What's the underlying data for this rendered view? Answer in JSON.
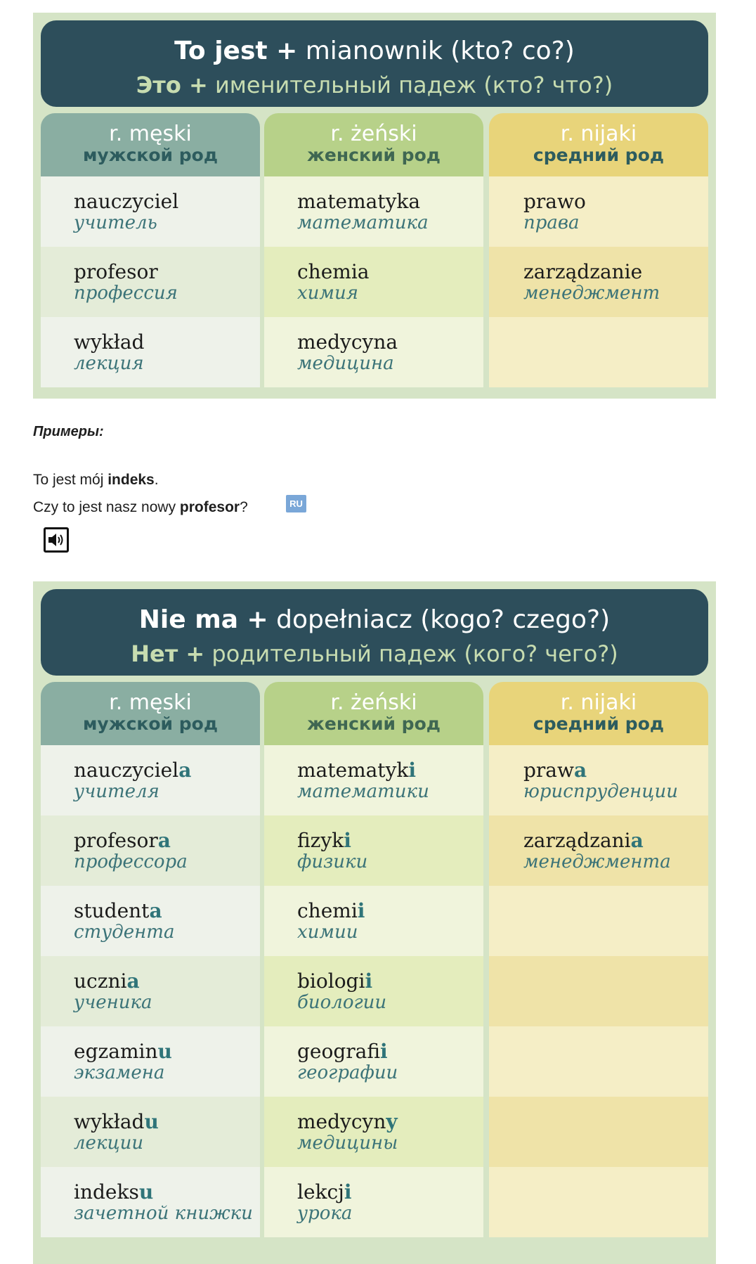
{
  "table1": {
    "title_pl_bold": "To jest +",
    "title_pl_rest": " mianownik (kto? co?)",
    "title_ru_bold": "Это +",
    "title_ru_rest": " именительный падеж (кто? что?)",
    "columns": [
      {
        "header_pl": "r. męski",
        "header_ru": "мужской род",
        "rows": [
          {
            "pl": "nauczyciel",
            "ru": "учитель"
          },
          {
            "pl": "profesor",
            "ru": "профессия"
          },
          {
            "pl": "wykład",
            "ru": "лекция"
          }
        ]
      },
      {
        "header_pl": "r. żeński",
        "header_ru": "женский род",
        "rows": [
          {
            "pl": "matematyka",
            "ru": "математика"
          },
          {
            "pl": "chemia",
            "ru": "химия"
          },
          {
            "pl": "medycyna",
            "ru": "медицина"
          }
        ]
      },
      {
        "header_pl": "r. nijaki",
        "header_ru": "средний род",
        "rows": [
          {
            "pl": "prawo",
            "ru": "права"
          },
          {
            "pl": "zarządzanie",
            "ru": "менеджмент"
          },
          {
            "pl": "",
            "ru": ""
          }
        ]
      }
    ]
  },
  "examples": {
    "heading": "Примеры:",
    "line1_pre": "To jest mój ",
    "line1_bold": "indeks",
    "line1_post": ".",
    "line2_pre": "Czy to jest nasz nowy ",
    "line2_bold": "profesor",
    "line2_post": "?",
    "ru_badge": "RU",
    "audio_icon": "speaker-icon"
  },
  "table2": {
    "title_pl_bold": "Nie ma +",
    "title_pl_rest": " dopełniacz (kogo? czego?)",
    "title_ru_bold": "Нет +",
    "title_ru_rest": " родительный падеж (кого? чего?)",
    "columns": [
      {
        "header_pl": "r. męski",
        "header_ru": "мужской род",
        "rows": [
          {
            "stem": "nauczyciel",
            "suffix": "a",
            "ru": "учителя"
          },
          {
            "stem": "profesor",
            "suffix": "a",
            "ru": "профессора"
          },
          {
            "stem": "student",
            "suffix": "a",
            "ru": "студента"
          },
          {
            "stem": "uczni",
            "suffix": "a",
            "ru": "ученика"
          },
          {
            "stem": "egzamin",
            "suffix": "u",
            "ru": "экзамена"
          },
          {
            "stem": "wykład",
            "suffix": "u",
            "ru": "лекции"
          },
          {
            "stem": "indeks",
            "suffix": "u",
            "ru": "зачетной книжки"
          }
        ]
      },
      {
        "header_pl": "r. żeński",
        "header_ru": "женский род",
        "rows": [
          {
            "stem": "matematyk",
            "suffix": "i",
            "ru": "математики"
          },
          {
            "stem": "fizyk",
            "suffix": "i",
            "ru": "физики"
          },
          {
            "stem": "chemi",
            "suffix": "i",
            "ru": "химии"
          },
          {
            "stem": "biologi",
            "suffix": "i",
            "ru": "биологии"
          },
          {
            "stem": "geografi",
            "suffix": "i",
            "ru": "географии"
          },
          {
            "stem": "medycyn",
            "suffix": "y",
            "ru": "медицины"
          },
          {
            "stem": "lekcj",
            "suffix": "i",
            "ru": "урока"
          }
        ]
      },
      {
        "header_pl": "r. nijaki",
        "header_ru": "средний род",
        "rows": [
          {
            "stem": "praw",
            "suffix": "a",
            "ru": "юриспруденции"
          },
          {
            "stem": "zarządzani",
            "suffix": "a",
            "ru": "менеджмента"
          },
          {
            "stem": "",
            "suffix": "",
            "ru": ""
          },
          {
            "stem": "",
            "suffix": "",
            "ru": ""
          },
          {
            "stem": "",
            "suffix": "",
            "ru": ""
          },
          {
            "stem": "",
            "suffix": "",
            "ru": ""
          },
          {
            "stem": "",
            "suffix": "",
            "ru": ""
          }
        ]
      }
    ]
  }
}
